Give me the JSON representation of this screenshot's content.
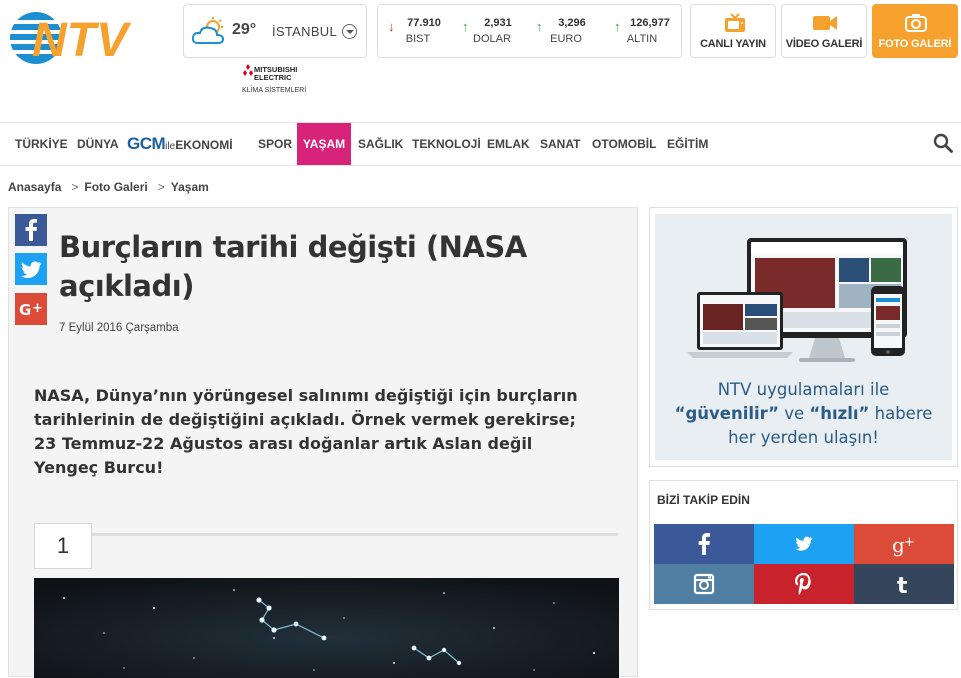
{
  "header": {
    "logo_alt": "NTV",
    "weather": {
      "temp": "29°",
      "city": "İSTANBUL"
    },
    "sponsor": {
      "brand_line1": "MITSUBISHI",
      "brand_line2": "ELECTRIC",
      "sub": "KLİMA SİSTEMLERİ"
    },
    "markets": [
      {
        "value": "77.910",
        "label": "BIST",
        "direction": "down",
        "color": "#c0392b"
      },
      {
        "value": "2,931",
        "label": "DOLAR",
        "direction": "up",
        "color": "#27a34a"
      },
      {
        "value": "3,296",
        "label": "EURO",
        "direction": "up",
        "color": "#27a34a"
      },
      {
        "value": "126,977",
        "label": "ALTIN",
        "direction": "up",
        "color": "#27a34a"
      }
    ],
    "buttons": [
      {
        "label": "CANLI YAYIN",
        "icon": "tv-icon"
      },
      {
        "label": "VİDEO GALERİ",
        "icon": "video-camera-icon"
      },
      {
        "label": "FOTO GALERİ",
        "icon": "photo-camera-icon",
        "active": true
      }
    ],
    "colors": {
      "brand_orange": "#f6a02d",
      "brand_blue": "#1d8fd0"
    }
  },
  "nav": {
    "items": [
      {
        "label": "TÜRKİYE"
      },
      {
        "label": "DÜNYA"
      },
      {
        "label": "EKONOMİ",
        "prefix": "GCM",
        "joiner": "ile"
      },
      {
        "label": "SPOR"
      },
      {
        "label": "YAŞAM",
        "active": true
      },
      {
        "label": "SAĞLIK"
      },
      {
        "label": "TEKNOLOJİ"
      },
      {
        "label": "EMLAK"
      },
      {
        "label": "SANAT"
      },
      {
        "label": "OTOMOBİL"
      },
      {
        "label": "EĞİTİM"
      }
    ],
    "active_color": "#d7237a"
  },
  "breadcrumb": [
    "Anasayfa",
    "Foto Galeri",
    "Yaşam"
  ],
  "breadcrumb_separator": ">",
  "article": {
    "title": "Burçların tarihi değişti (NASA açıkladı)",
    "date": "7 Eylül 2016 Çarşamba",
    "lead": "NASA, Dünya’nın yörüngesel salınımı değiştiği için burçların tarihlerinin de değiştiğini açıkladı. Örnek vermek gerekirse; 23 Temmuz-22 Ağustos arası doğanlar artık Aslan değil Yengeç Burcu!",
    "page_number": "1",
    "share": [
      {
        "network": "facebook",
        "color": "#3b5998"
      },
      {
        "network": "twitter",
        "color": "#1da1f2"
      },
      {
        "network": "google-plus",
        "color": "#dc4a38"
      }
    ]
  },
  "sidebar": {
    "promo": {
      "line1": "NTV uygulamaları ile",
      "q1": "“güvenilir”",
      "and": " ve ",
      "q2": "“hızlı”",
      "line2_end": " habere",
      "line3": "her yerden ulaşın!"
    },
    "follow": {
      "title": "BİZİ TAKİP EDİN",
      "networks": [
        {
          "name": "facebook",
          "color": "#3b5998"
        },
        {
          "name": "twitter",
          "color": "#1da1f2"
        },
        {
          "name": "google-plus",
          "color": "#dc4a38"
        },
        {
          "name": "instagram",
          "color": "#517fa4"
        },
        {
          "name": "pinterest",
          "color": "#c8232c"
        },
        {
          "name": "tumblr",
          "color": "#35465c"
        }
      ]
    }
  }
}
